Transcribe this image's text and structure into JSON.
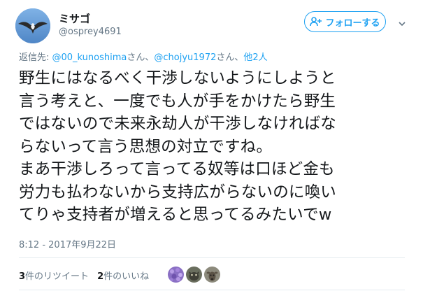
{
  "author": {
    "display_name": "ミサゴ",
    "username": "@osprey4691",
    "avatar_icon": "osprey-avatar-icon"
  },
  "follow_button": {
    "label": "フォローする",
    "icon": "add-user-icon",
    "color": "#1da1f2"
  },
  "menu_icon": "chevron-down-icon",
  "reply_context": {
    "prefix": "返信先: ",
    "mentions": [
      {
        "handle": "@00_kunoshima",
        "suffix": "さん、"
      },
      {
        "handle": "@chojyu1972",
        "suffix": "さん、"
      }
    ],
    "others": "他2人"
  },
  "tweet": {
    "lines": [
      "野生にはなるべく干渉しないようにしようと",
      "言う考えと、一度でも人が手をかけたら野生",
      "ではないので未来永劫人が干渉しなければな",
      "らないって言う思想の対立ですね。",
      "まあ干渉しろって言ってる奴等は口ほど金も",
      "労力も払わないから支持広がらないのに喚い",
      "てりゃ支持者が増えると思ってるみたいでw"
    ]
  },
  "timestamp": "8:12 - 2017年9月22日",
  "stats": {
    "retweet_count": "3",
    "retweet_label": "件のリツイート",
    "like_count": "2",
    "like_label": "件のいいね"
  },
  "likers": [
    {
      "icon": "purple-flower-avatar-icon"
    },
    {
      "icon": "animal-avatar-icon"
    },
    {
      "icon": "deer-avatar-icon"
    }
  ]
}
